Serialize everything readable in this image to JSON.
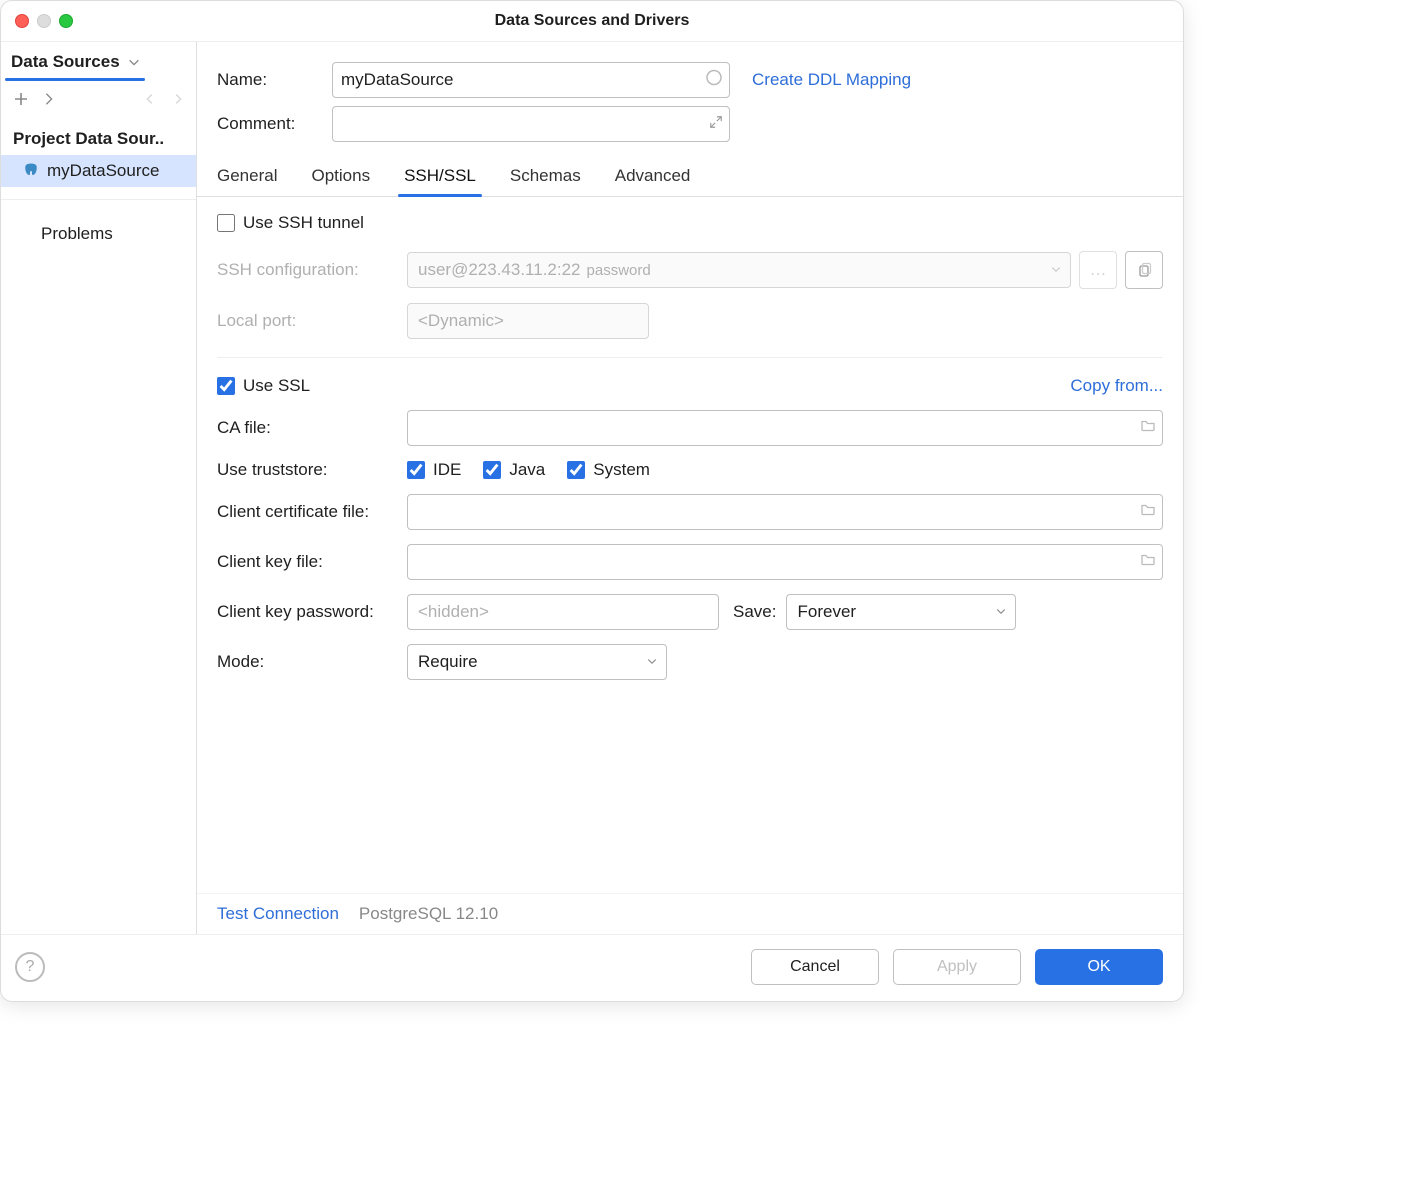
{
  "window": {
    "title": "Data Sources and Drivers"
  },
  "sidebar": {
    "tab_label": "Data Sources",
    "section": "Project Data Sour..",
    "item": "myDataSource",
    "problems": "Problems"
  },
  "top": {
    "name_label": "Name:",
    "name_value": "myDataSource",
    "comment_label": "Comment:",
    "ddl_link": "Create DDL Mapping"
  },
  "tabs": [
    "General",
    "Options",
    "SSH/SSL",
    "Schemas",
    "Advanced"
  ],
  "ssh": {
    "use_label": "Use SSH tunnel",
    "conf_label": "SSH configuration:",
    "conf_value": "user@223.43.11.2:22",
    "conf_suffix": "password",
    "local_port_label": "Local port:",
    "local_port_value": "<Dynamic>"
  },
  "ssl": {
    "use_label": "Use SSL",
    "copy_link": "Copy from...",
    "ca_label": "CA file:",
    "ts_label": "Use truststore:",
    "ts_ide": "IDE",
    "ts_java": "Java",
    "ts_system": "System",
    "client_cert_label": "Client certificate file:",
    "client_key_label": "Client key file:",
    "client_pw_label": "Client key password:",
    "client_pw_placeholder": "<hidden>",
    "save_label": "Save:",
    "save_value": "Forever",
    "mode_label": "Mode:",
    "mode_value": "Require"
  },
  "footer": {
    "test": "Test Connection",
    "driver": "PostgreSQL 12.10"
  },
  "buttons": {
    "cancel": "Cancel",
    "apply": "Apply",
    "ok": "OK"
  }
}
